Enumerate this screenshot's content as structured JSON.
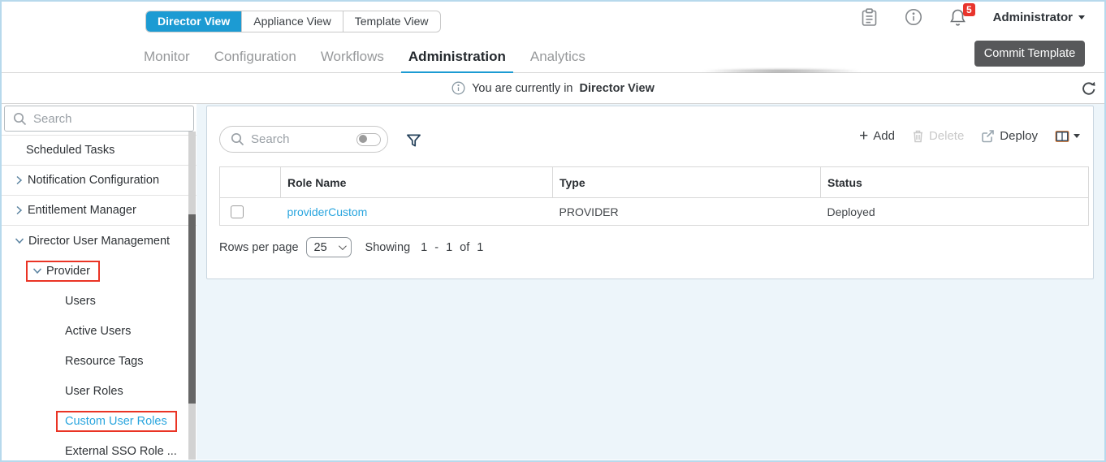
{
  "header": {
    "view_switcher": [
      {
        "label": "Director View",
        "active": true
      },
      {
        "label": "Appliance View",
        "active": false
      },
      {
        "label": "Template View",
        "active": false
      }
    ],
    "notification_badge": "5",
    "user_menu_label": "Administrator",
    "nav_tabs": [
      {
        "label": "Monitor",
        "active": false
      },
      {
        "label": "Configuration",
        "active": false
      },
      {
        "label": "Workflows",
        "active": false
      },
      {
        "label": "Administration",
        "active": true
      },
      {
        "label": "Analytics",
        "active": false
      }
    ],
    "commit_button_label": "Commit Template"
  },
  "banner": {
    "message_prefix": "You are currently in",
    "message_bold": "Director View"
  },
  "sidebar": {
    "search_placeholder": "Search",
    "items": [
      {
        "label": "Scheduled Tasks"
      },
      {
        "label": "Notification Configuration"
      },
      {
        "label": "Entitlement Manager"
      },
      {
        "label": "Director User Management"
      },
      {
        "label": "Provider"
      },
      {
        "label": "Users"
      },
      {
        "label": "Active Users"
      },
      {
        "label": "Resource Tags"
      },
      {
        "label": "User Roles"
      },
      {
        "label": "Custom User Roles"
      },
      {
        "label": "External SSO Role ..."
      }
    ]
  },
  "content": {
    "search_placeholder": "Search",
    "actions": {
      "add": "Add",
      "delete": "Delete",
      "deploy": "Deploy"
    },
    "table": {
      "columns": [
        "",
        "Role Name",
        "Type",
        "Status"
      ],
      "rows": [
        {
          "role_name": "providerCustom",
          "type": "PROVIDER",
          "status": "Deployed"
        }
      ]
    },
    "pagination": {
      "rows_per_page_label": "Rows per page",
      "rows_per_page_value": "25",
      "showing_label": "Showing",
      "range_start": "1",
      "range_separator": "-",
      "range_end": "1",
      "of_label": "of",
      "total": "1"
    }
  },
  "colors": {
    "accent_blue": "#1c9bd3",
    "link_blue": "#29a5de",
    "badge_red": "#e8352d",
    "annotation_red": "#ea3425",
    "commit_button_gray": "#57585a"
  }
}
